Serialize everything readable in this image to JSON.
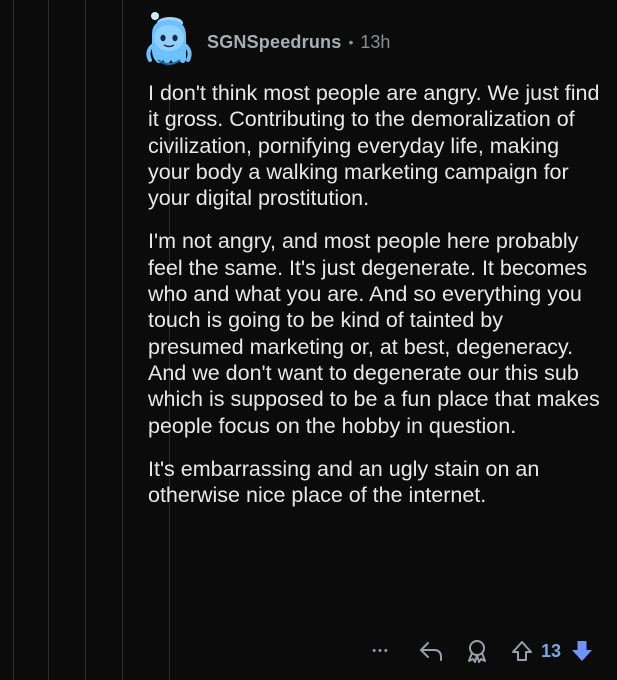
{
  "comment": {
    "username": "SGNSpeedruns",
    "separator": "•",
    "time": "13h",
    "paragraphs": [
      "I don't think most people are angry. We just find it gross. Contributing to the demoralization of  civilization, pornifying everyday life, making your body a walking marketing campaign for your digital prostitution.",
      "I'm not angry, and most people here probably feel the same. It's just degenerate. It becomes who and what you are. And so everything you touch is going to be kind of tainted by presumed marketing or, at best, degeneracy. And we don't want to degenerate our this sub which is supposed to be a fun place that makes people focus on the hobby in question.",
      "It's embarrassing and an ugly stain on an otherwise nice place of the internet."
    ]
  },
  "actions": {
    "more_label": "•••",
    "score": "13"
  },
  "icons": {
    "avatar": "snoo-avatar-icon",
    "reply": "reply-arrow-icon",
    "award": "award-icon",
    "upvote": "upvote-arrow-icon",
    "downvote": "downvote-arrow-icon"
  },
  "colors": {
    "background": "#0b0b0b",
    "text": "#e8e8e8",
    "meta": "#a9aeb3",
    "downvote_active": "#7193ff",
    "score": "#7ba7e0"
  }
}
